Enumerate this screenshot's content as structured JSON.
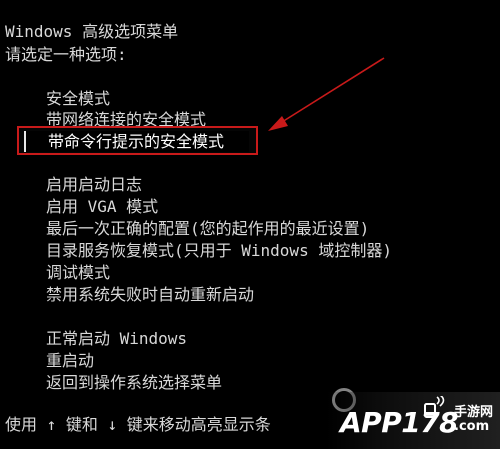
{
  "header": {
    "title": "Windows 高级选项菜单",
    "prompt": "请选定一种选项:"
  },
  "menu": {
    "group1": [
      "安全模式",
      "带网络连接的安全模式",
      "带命令行提示的安全模式"
    ],
    "group2": [
      "启用启动日志",
      "启用 VGA 模式",
      "最后一次正确的配置(您的起作用的最近设置)",
      "目录服务恢复模式(只用于 Windows 域控制器)",
      "调试模式",
      "禁用系统失败时自动重新启动"
    ],
    "group3": [
      "正常启动 Windows",
      "重启动",
      "返回到操作系统选择菜单"
    ],
    "selected": "带命令行提示的安全模式"
  },
  "footer": {
    "hint": "使用 ↑ 键和 ↓ 键来移动高亮显示条"
  },
  "watermark": {
    "logo": "APP178",
    "site_line1": "手游网",
    "site_line2": ".com"
  },
  "colors": {
    "background": "#000000",
    "text": "#d8d8d8",
    "annotation": "#c81a1a"
  }
}
